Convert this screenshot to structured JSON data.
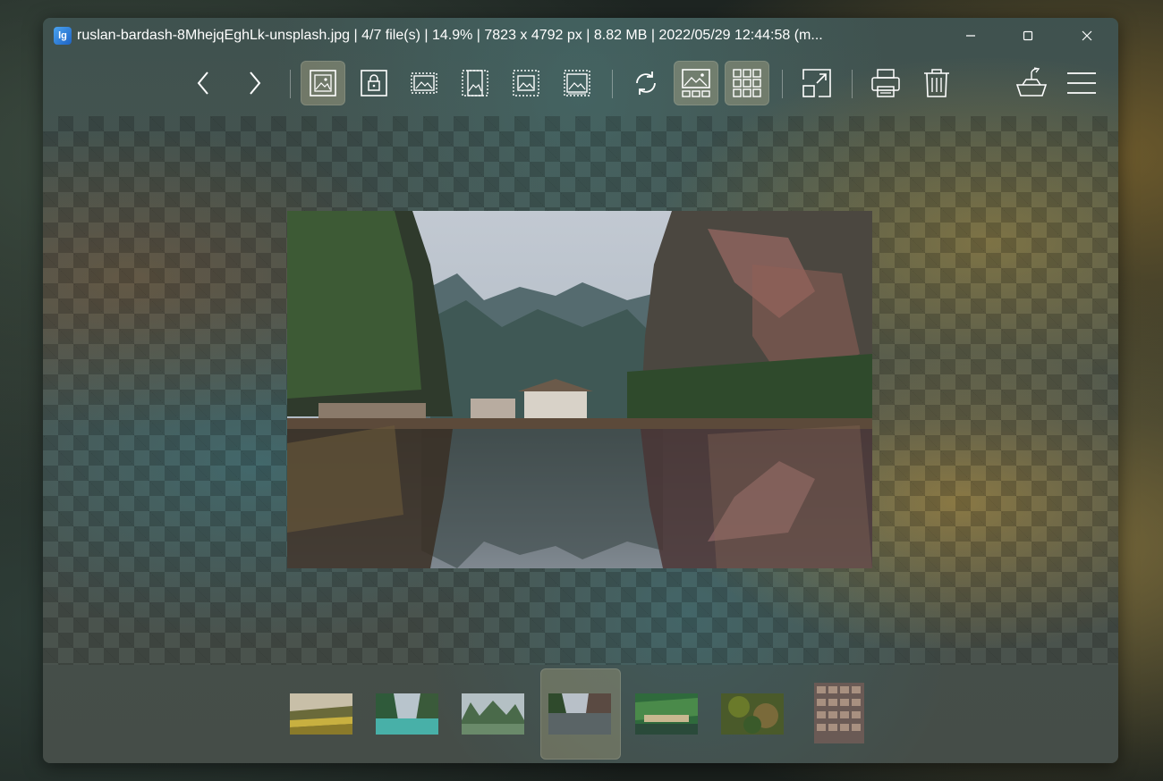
{
  "window": {
    "title": "ruslan-bardash-8MhejqEghLk-unsplash.jpg  |  4/7 file(s)  |  14.9%  |  7823 x 4792 px  |  8.82 MB  |  2022/05/29 12:44:58 (m...",
    "app_icon_text": "lg"
  },
  "toolbar": {
    "buttons": [
      {
        "name": "previous-image",
        "icon": "chevron-left-icon"
      },
      {
        "name": "next-image",
        "icon": "chevron-right-icon"
      },
      {
        "name": "auto-zoom",
        "icon": "image-frame-icon",
        "active": true
      },
      {
        "name": "lock-zoom",
        "icon": "image-lock-icon"
      },
      {
        "name": "scale-to-width",
        "icon": "scale-width-icon"
      },
      {
        "name": "scale-to-height",
        "icon": "scale-height-icon"
      },
      {
        "name": "scale-to-fit",
        "icon": "scale-fit-icon"
      },
      {
        "name": "scale-to-fill",
        "icon": "scale-fill-icon"
      },
      {
        "name": "rotate",
        "icon": "rotate-icon"
      },
      {
        "name": "gallery",
        "icon": "gallery-icon",
        "active": true
      },
      {
        "name": "thumbnails",
        "icon": "grid-icon",
        "active": true
      },
      {
        "name": "fullscreen",
        "icon": "expand-icon"
      },
      {
        "name": "print",
        "icon": "printer-icon"
      },
      {
        "name": "delete",
        "icon": "trash-icon"
      },
      {
        "name": "share",
        "icon": "basket-share-icon"
      },
      {
        "name": "menu",
        "icon": "hamburger-icon"
      }
    ]
  },
  "thumbnails": {
    "count": 7,
    "active_index": 3,
    "colors": [
      "#8a8a6a",
      "#3f8d8a",
      "#5a7a58",
      "#4a5a6a",
      "#2f6a3c",
      "#5a6a2a",
      "#8a6a5a"
    ]
  },
  "colors": {
    "accent_active": "#c8be96"
  }
}
